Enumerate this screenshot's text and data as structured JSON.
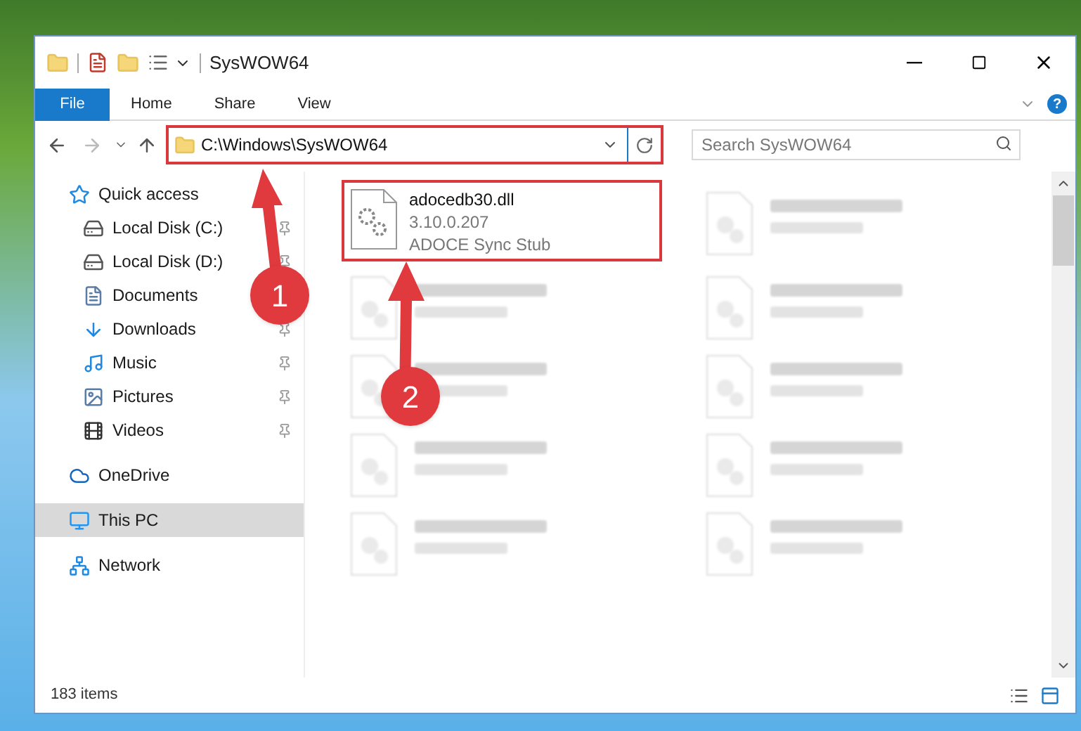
{
  "window": {
    "title": "SysWOW64"
  },
  "ribbon_tabs": [
    {
      "label": "File",
      "selected": true
    },
    {
      "label": "Home",
      "selected": false
    },
    {
      "label": "Share",
      "selected": false
    },
    {
      "label": "View",
      "selected": false
    }
  ],
  "address_bar": {
    "value": "C:\\Windows\\SysWOW64",
    "highlighted": true
  },
  "search": {
    "placeholder": "Search SysWOW64"
  },
  "sidebar": {
    "items": [
      {
        "label": "Quick access",
        "kind": "quick",
        "selected": false,
        "children": [
          {
            "label": "Local Disk (C:)",
            "kind": "diskc",
            "pinned": true
          },
          {
            "label": "Local Disk (D:)",
            "kind": "disk",
            "pinned": true
          },
          {
            "label": "Documents",
            "kind": "documents"
          },
          {
            "label": "Downloads",
            "kind": "downloads",
            "pinned": true
          },
          {
            "label": "Music",
            "kind": "music",
            "pinned": true
          },
          {
            "label": "Pictures",
            "kind": "pictures",
            "pinned": true
          },
          {
            "label": "Videos",
            "kind": "videos",
            "pinned": true
          }
        ]
      },
      {
        "label": "OneDrive",
        "kind": "cloud",
        "selected": false
      },
      {
        "label": "This PC",
        "kind": "pc",
        "selected": true
      },
      {
        "label": "Network",
        "kind": "network",
        "selected": false
      }
    ]
  },
  "files": [
    {
      "name": "adocedb30.dll",
      "lines": [
        "3.10.0.207",
        "ADOCE Sync Stub"
      ],
      "highlighted": true
    }
  ],
  "help": {
    "label": "?"
  },
  "annotations": [
    {
      "label": "1"
    },
    {
      "label": "2"
    }
  ],
  "status_bar": {
    "count": "183 items"
  }
}
